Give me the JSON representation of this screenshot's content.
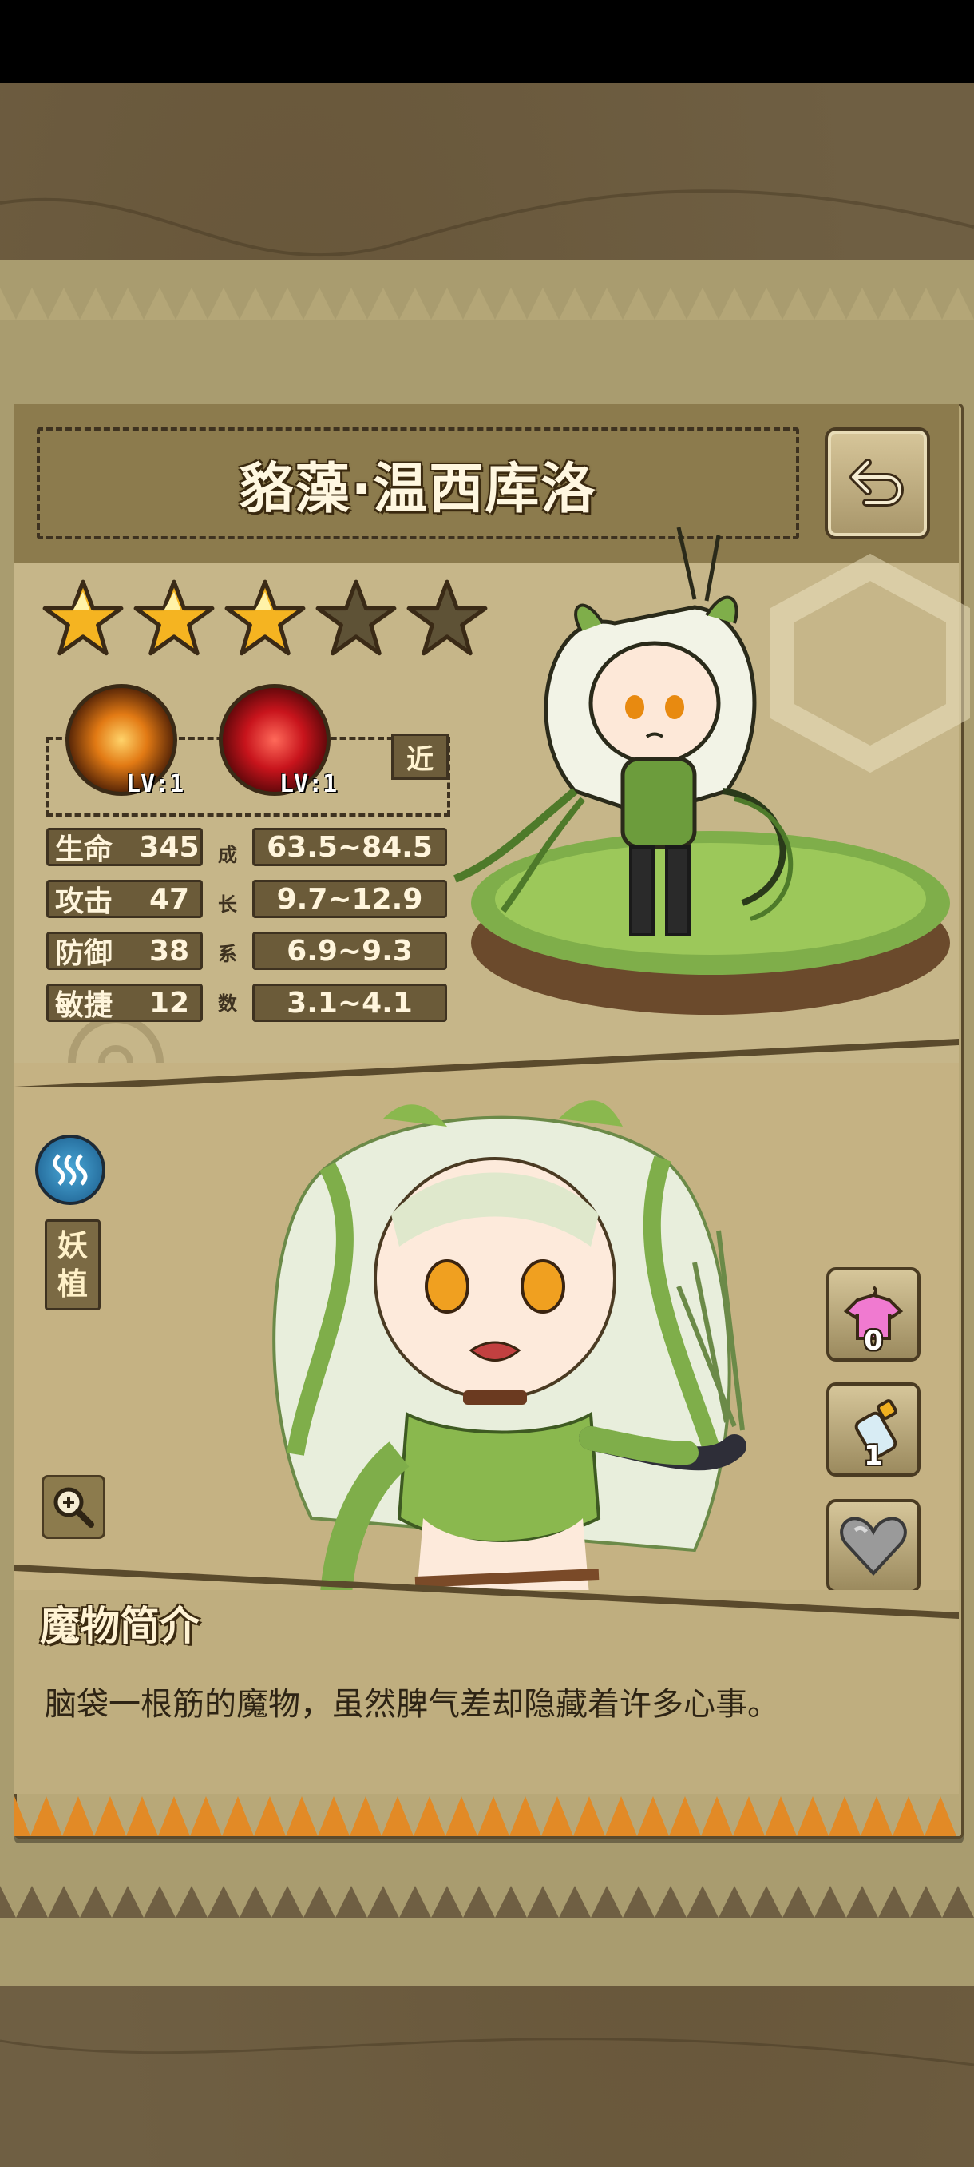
{
  "character": {
    "name": "貉藻·温西库洛",
    "stars_filled": 3,
    "stars_total": 5
  },
  "skills": [
    {
      "name": "fire-skill-icon",
      "level": "LV:1",
      "color": "#e9a13a"
    },
    {
      "name": "red-skill-icon",
      "level": "LV:1",
      "color": "#c8141c"
    }
  ],
  "range_tag": "近",
  "stats": [
    {
      "label": "生命",
      "value": "345",
      "growth": "63.5~84.5"
    },
    {
      "label": "攻击",
      "value": "47",
      "growth": "9.7~12.9"
    },
    {
      "label": "防御",
      "value": "38",
      "growth": "6.9~9.3"
    },
    {
      "label": "敏捷",
      "value": "12",
      "growth": "3.1~4.1"
    }
  ],
  "growth_label": [
    "成",
    "长",
    "系",
    "数"
  ],
  "element": {
    "icon": "water-wave-icon",
    "color": "#2f8cc4"
  },
  "type_badge": [
    "妖",
    "植"
  ],
  "side_buttons": [
    {
      "icon": "outfit-icon",
      "count": "0"
    },
    {
      "icon": "bottle-icon",
      "count": "1"
    },
    {
      "icon": "heart-icon",
      "count": ""
    }
  ],
  "description": {
    "title": "魔物简介",
    "text": "脑袋一根筋的魔物，虽然脾气差却隐藏着许多心事。"
  },
  "colors": {
    "panel": "#b8a878",
    "dark": "#3e3220",
    "star": "#f5b421",
    "accent_green": "#7fae4a"
  }
}
